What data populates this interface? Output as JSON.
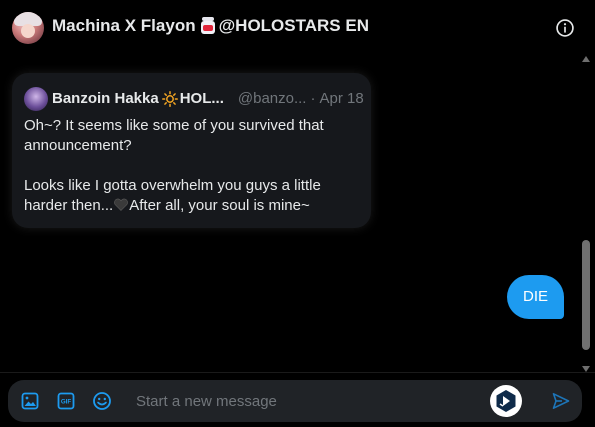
{
  "header": {
    "title_name": "Machina X Flayon",
    "title_suffix": "@HOLOSTARS EN",
    "info_icon": "info-circle-icon"
  },
  "quote": {
    "name": "Banzoin Hakka",
    "name_suffix": "HOL...",
    "handle": "@banzo...",
    "separator": "·",
    "date": "Apr 18",
    "text_part1": "Oh~? It seems like some of you survived that announcement?\n\nLooks like I gotta overwhelm you guys a little harder then...",
    "text_part2": "After all, your soul is mine~"
  },
  "messages": [
    {
      "text": "DIE",
      "direction": "sent"
    }
  ],
  "composer": {
    "placeholder": "Start a new message",
    "icons": [
      "media-icon",
      "gif-icon",
      "emoji-icon",
      "extension-icon",
      "send-icon"
    ]
  },
  "colors": {
    "accent": "#1d9bf0",
    "background": "#000000",
    "composer_bg": "#202327",
    "muted_text": "#71767b"
  }
}
